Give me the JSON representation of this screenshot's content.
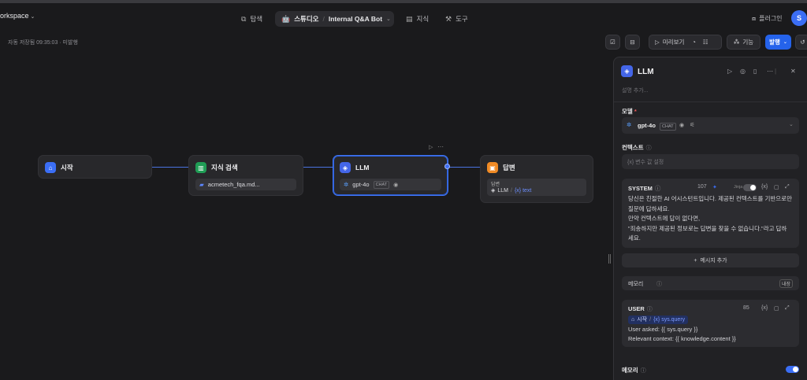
{
  "header": {
    "workspace": "orkspace",
    "tabs": [
      {
        "label": "탐색",
        "icon": "copy-icon"
      },
      {
        "label": "지식",
        "icon": "book-icon"
      },
      {
        "label": "도구",
        "icon": "tool-icon"
      }
    ],
    "studio": {
      "label": "스튜디오",
      "app_name": "Internal Q&A Bot"
    },
    "plugin_label": "플러그인",
    "avatar_initial": "S"
  },
  "toolbar": {
    "autosave": "자동 저장됨 09:35:03 · 미발행",
    "preview_label": "미리보기",
    "features_label": "기능",
    "publish_label": "발행"
  },
  "nodes": {
    "start": {
      "title": "시작"
    },
    "knowledge": {
      "title": "지식 검색",
      "dataset": "acmetech_fqa.md..."
    },
    "llm": {
      "title": "LLM",
      "model": "gpt-4o",
      "chip": "CHAT"
    },
    "answer": {
      "title": "답변",
      "label": "답변",
      "ref_node": "LLM",
      "ref_var": "{x} text"
    }
  },
  "panel": {
    "title": "LLM",
    "description_placeholder": "설명 추가...",
    "model": {
      "label": "모델",
      "required": "*",
      "value": "gpt-4o",
      "chip": "CHAT"
    },
    "context": {
      "label": "컨텍스트",
      "placeholder": "{x}  변수 값 설정"
    },
    "system": {
      "label": "SYSTEM",
      "count": "107",
      "jinja": "Jinja",
      "lines": [
        "당신은 친절한 AI 어시스턴트입니다. 제공된 컨텍스트를 기반으로만",
        "질문에 답하세요.",
        "만약 컨텍스트에 답이 없다면,",
        "\"죄송하지만 제공된 정보로는 답변을 찾을 수 없습니다.\"라고 답하",
        "세요."
      ]
    },
    "add_message": "메시지 추가",
    "memory_row": {
      "label": "메모리",
      "badge": "내장"
    },
    "user": {
      "label": "USER",
      "count": "85",
      "var_node": "시작",
      "var_name": "{x} sys.query",
      "lines": [
        "User asked: {{ sys.query }}",
        "Relevant context: {{ knowledge.content }}"
      ]
    },
    "memory_toggle": {
      "label": "메모리",
      "enabled": true
    }
  },
  "colors": {
    "accent": "#3b6ef5",
    "start": "#3b6ef5",
    "knowledge": "#1f9d55",
    "llm": "#4466e8",
    "answer": "#f08a24"
  }
}
